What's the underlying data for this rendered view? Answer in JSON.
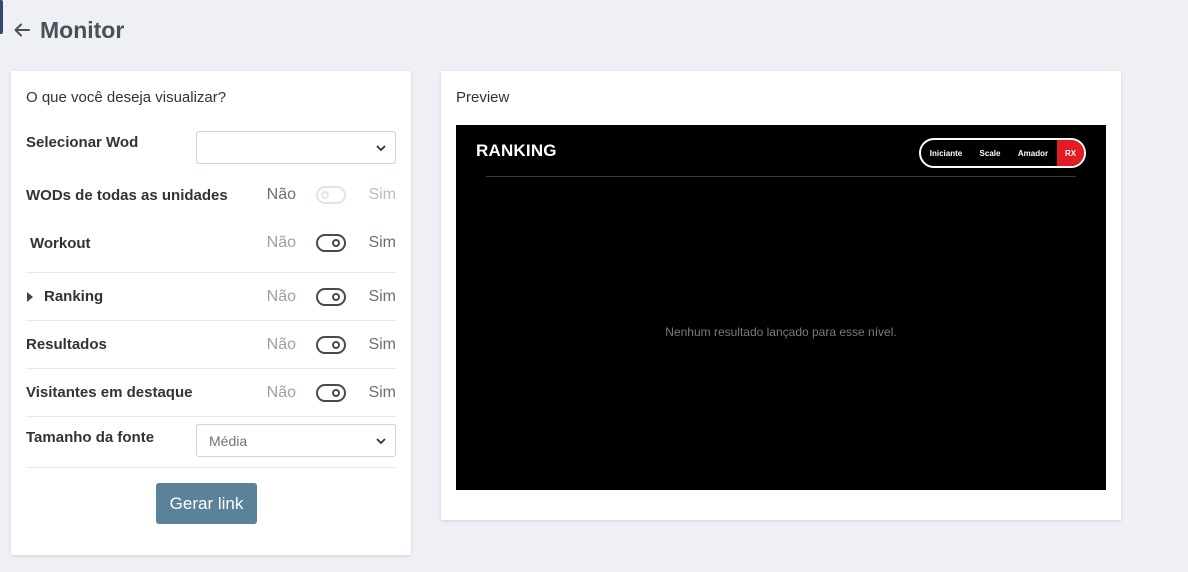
{
  "header": {
    "back_icon": "arrow-left-icon",
    "title": "Monitor"
  },
  "form": {
    "question": "O que você deseja visualizar?",
    "select_wod": {
      "label": "Selecionar Wod",
      "value": ""
    },
    "toggles": [
      {
        "label": "WODs de todas as unidades",
        "off_label": "Não",
        "on_label": "Sim",
        "state": "off",
        "disabled": true
      },
      {
        "label": "Workout",
        "off_label": "Não",
        "on_label": "Sim",
        "state": "on"
      },
      {
        "label": "Ranking",
        "off_label": "Não",
        "on_label": "Sim",
        "state": "on",
        "expandable": true
      },
      {
        "label": "Resultados",
        "off_label": "Não",
        "on_label": "Sim",
        "state": "on"
      },
      {
        "label": "Visitantes em destaque",
        "off_label": "Não",
        "on_label": "Sim",
        "state": "on"
      }
    ],
    "font_size": {
      "label": "Tamanho da fonte",
      "value": "Média"
    },
    "generate_button": "Gerar link"
  },
  "preview": {
    "label": "Preview",
    "screen_title": "RANKING",
    "levels": [
      "Iniciante",
      "Scale",
      "Amador",
      "RX"
    ],
    "active_level": "RX",
    "empty_message": "Nenhum resultado lançado para esse nível."
  },
  "colors": {
    "background": "#eef0f5",
    "accent_button": "#5a8299",
    "active_level": "#e31b23",
    "preview_background": "#000000"
  }
}
